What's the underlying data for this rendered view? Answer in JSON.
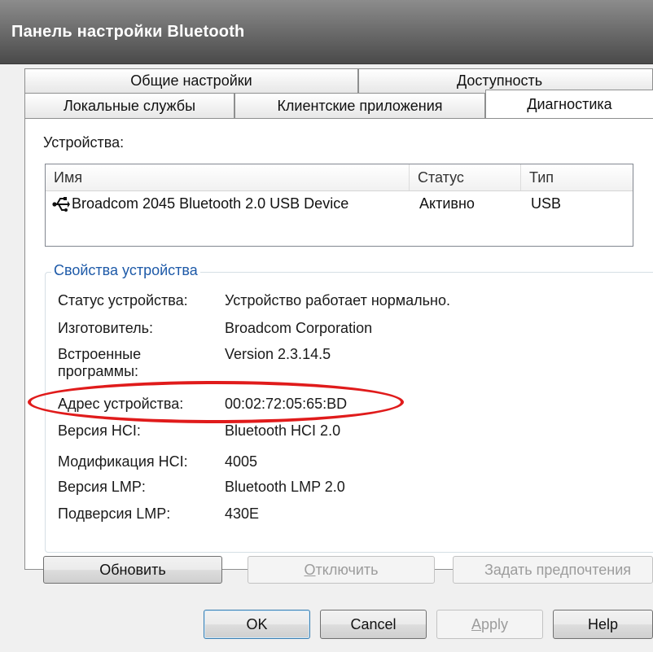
{
  "window": {
    "title": "Панель настройки Bluetooth"
  },
  "tabs": {
    "row1": [
      {
        "label": "Общие настройки"
      },
      {
        "label": "Доступность"
      }
    ],
    "row2": [
      {
        "label": "Локальные службы"
      },
      {
        "label": "Клиентские приложения"
      },
      {
        "label": "Диагностика",
        "selected": true
      }
    ]
  },
  "devices": {
    "label": "Устройства:",
    "columns": [
      "Имя",
      "Статус",
      "Тип"
    ],
    "rows": [
      {
        "icon": "usb-icon",
        "name": "Broadcom 2045 Bluetooth 2.0 USB Device",
        "status": "Активно",
        "type": "USB"
      }
    ]
  },
  "properties": {
    "title": "Свойства устройства",
    "items": [
      {
        "label": "Статус устройства:",
        "value": "Устройство работает нормально."
      },
      {
        "label": "Изготовитель:",
        "value": "Broadcom Corporation"
      },
      {
        "label_line1": "Встроенные",
        "label_line2": "программы:",
        "value": "Version 2.3.14.5"
      },
      {
        "label": "Адрес устройства:",
        "value": "00:02:72:05:65:BD",
        "highlighted": true
      },
      {
        "label": "Версия HCI:",
        "value": "Bluetooth HCI 2.0"
      },
      {
        "label": "Модификация HCI:",
        "value": "4005"
      },
      {
        "label": "Версия LMP:",
        "value": "Bluetooth LMP 2.0"
      },
      {
        "label": "Подверсия LMP:",
        "value": "430E"
      }
    ]
  },
  "panel_buttons": {
    "refresh": "Обновить",
    "disconnect_mnemonic": "О",
    "disconnect_rest": "тключить",
    "set_preferences": "Задать предпочтения"
  },
  "dialog_buttons": {
    "ok": "OK",
    "cancel": "Cancel",
    "apply_mnemonic": "A",
    "apply_rest": "pply",
    "help": "Help"
  },
  "colors": {
    "highlight_oval": "#e01b1b",
    "group_title": "#1e5aa8",
    "titlebar": "#5a5a5a"
  }
}
